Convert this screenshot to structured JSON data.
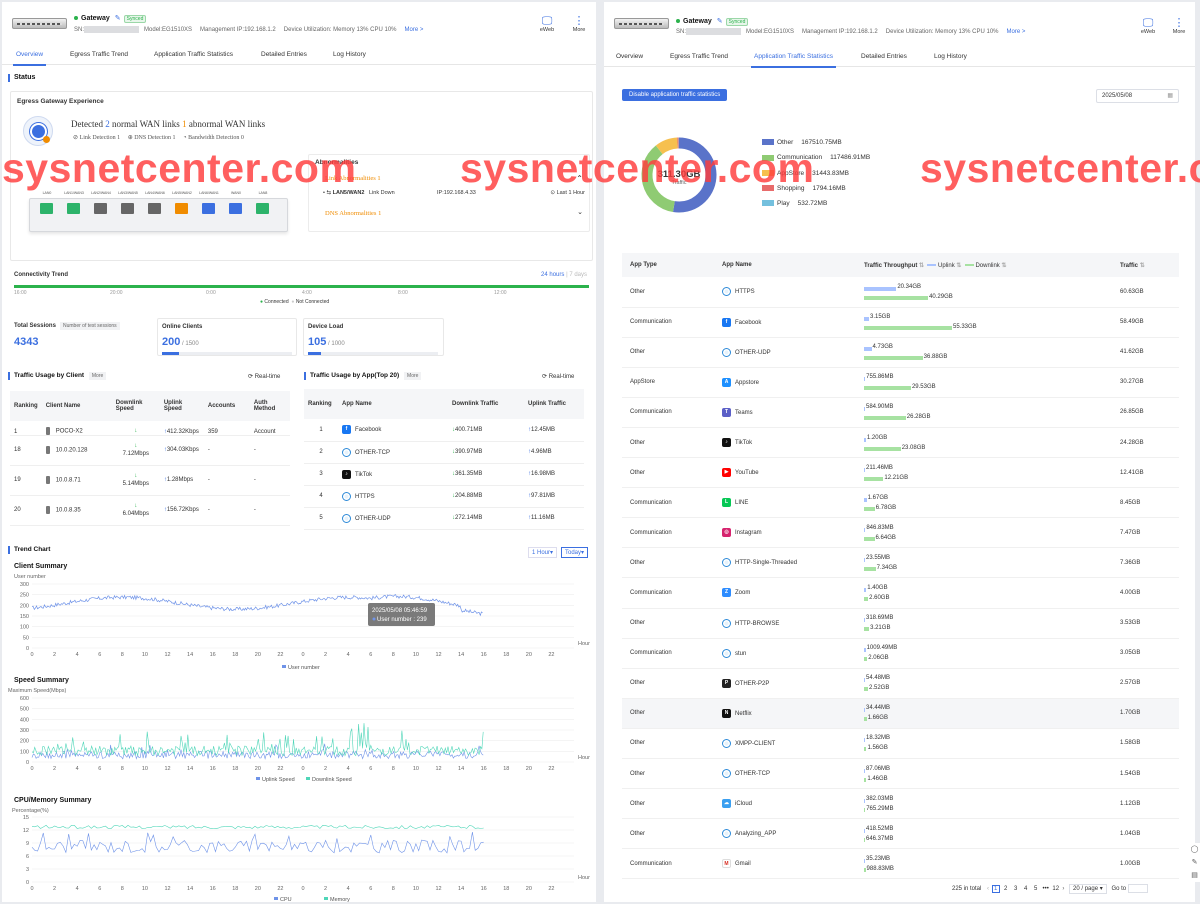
{
  "watermark": "sysnetcenter.com",
  "header": {
    "device_name": "Gateway",
    "synced": "Synced",
    "sn_label": "SN:",
    "model": "Model:EG1510XS",
    "mgmt_ip": "Management IP:192.168.1.2",
    "utilization": "Device Utilization: Memory 13% CPU 10%",
    "more": "More >",
    "eweb": "eWeb",
    "more_btn": "More"
  },
  "tabs": [
    "Overview",
    "Egress Traffic Trend",
    "Application Traffic Statistics",
    "Detailed Entries",
    "Log History"
  ],
  "overview": {
    "status_title": "Status",
    "egress_title": "Egress Gateway Experience",
    "detected_pre": "Detected",
    "normal_count": "2",
    "normal_text": "normal WAN links",
    "abnormal_count": "1",
    "abnormal_text": "abnormal WAN links",
    "link_detection": "Link Detection 1",
    "dns_detection": "DNS Detection 1",
    "bandwidth_detection": "Bandwidth Detection 0",
    "abnormalities_title": "Abnormalities",
    "link_abn": "Link Abnormalities 1",
    "abn_port": "LAN5/WAN2",
    "abn_state": "Link Down",
    "abn_ip": "IP:192.168.4.33",
    "abn_time": "Last 1 Hour",
    "dns_abn": "DNS Abnormalities 1",
    "ports": [
      {
        "label": "LAN0",
        "color": "#2db36a"
      },
      {
        "label": "LAN1/WAN3",
        "color": "#2db36a"
      },
      {
        "label": "LAN2/WAN4",
        "color": "#666"
      },
      {
        "label": "LAN3/WAN5",
        "color": "#666"
      },
      {
        "label": "LAN4/WAN6",
        "color": "#666"
      },
      {
        "label": "LAN5/WAN2",
        "color": "#f08c00"
      },
      {
        "label": "LAN6/WAN1",
        "color": "#3b6fe0"
      },
      {
        "label": "WAN0",
        "color": "#3b6fe0"
      },
      {
        "label": "LAN8",
        "color": "#2db36a"
      }
    ],
    "connectivity_title": "Connectivity Trend",
    "range_24h": "24 hours",
    "range_sep": "|",
    "range_7d": "7 days",
    "conn_ticks": [
      "16:00",
      "20:00",
      "0:00",
      "4:00",
      "8:00",
      "12:00"
    ],
    "legend_connected": "Connected",
    "legend_not_connected": "Not Connected",
    "total_sessions_label": "Total Sessions",
    "test_sessions": "Number of test sessions",
    "total_sessions": "4343",
    "online_clients_label": "Online Clients",
    "online_clients": "200",
    "online_clients_max": "/ 1500",
    "online_clients_frac": 0.13,
    "device_load_label": "Device Load",
    "device_load": "105",
    "device_load_max": "/ 1000",
    "device_load_frac": 0.1,
    "client_usage_title": "Traffic Usage by Client",
    "more": "More",
    "realtime": "Real-time",
    "client_cols": [
      "Ranking",
      "Client Name",
      "Downlink Speed",
      "Uplink Speed",
      "Accounts",
      "Auth Method"
    ],
    "clients": [
      {
        "rank": "1",
        "name": "POCO-X2",
        "down": "",
        "up": "412.32Kbps",
        "acc": "359",
        "auth": "Account"
      },
      {
        "rank": "18",
        "name": "10.0.20.128",
        "down": "7.12Mbps",
        "up": "304.03Kbps",
        "acc": "-",
        "auth": "-"
      },
      {
        "rank": "19",
        "name": "10.0.8.71",
        "down": "5.14Mbps",
        "up": "1.28Mbps",
        "acc": "-",
        "auth": "-"
      },
      {
        "rank": "20",
        "name": "10.0.8.35",
        "down": "6.04Mbps",
        "up": "156.72Kbps",
        "acc": "-",
        "auth": "-"
      }
    ],
    "app_usage_title": "Traffic Usage by App(Top 20)",
    "app_cols": [
      "Ranking",
      "App Name",
      "Downlink Traffic",
      "Uplink Traffic"
    ],
    "apps": [
      {
        "rank": "1",
        "name": "Facebook",
        "down": "400.71MB",
        "up": "12.45MB"
      },
      {
        "rank": "2",
        "name": "OTHER-TCP",
        "down": "390.97MB",
        "up": "4.96MB"
      },
      {
        "rank": "3",
        "name": "TikTok",
        "down": "361.35MB",
        "up": "16.98MB"
      },
      {
        "rank": "4",
        "name": "HTTPS",
        "down": "204.88MB",
        "up": "97.81MB"
      },
      {
        "rank": "5",
        "name": "OTHER-UDP",
        "down": "272.14MB",
        "up": "11.16MB"
      }
    ],
    "trend_title": "Trend Chart",
    "interval": "1 Hour",
    "period": "Today"
  },
  "chart_data": [
    {
      "type": "line",
      "title": "Client Summary",
      "ylabel": "User number",
      "xlabel": "Hour",
      "ylim": [
        0,
        300
      ],
      "yticks": [
        0,
        50,
        100,
        150,
        200,
        250,
        300
      ],
      "xticks": [
        0,
        2,
        4,
        6,
        8,
        10,
        12,
        14,
        16,
        18,
        20,
        22,
        0,
        2,
        4,
        6,
        8,
        10,
        12,
        14,
        16,
        18,
        20,
        22
      ],
      "series": [
        {
          "name": "User number",
          "color": "#6f93e8"
        }
      ],
      "tooltip_time": "2025/05/08 05:46:59",
      "tooltip_value": "User number : 239"
    },
    {
      "type": "line",
      "title": "Speed Summary",
      "ylabel": "Maximum Speed(Mbps)",
      "xlabel": "Hour",
      "ylim": [
        0,
        600
      ],
      "yticks": [
        0,
        100,
        200,
        300,
        400,
        500,
        600
      ],
      "xticks": [
        0,
        2,
        4,
        6,
        8,
        10,
        12,
        14,
        16,
        18,
        20,
        22,
        0,
        2,
        4,
        6,
        8,
        10,
        12,
        14,
        16,
        18,
        20,
        22
      ],
      "series": [
        {
          "name": "Uplink Speed",
          "color": "#6f93e8"
        },
        {
          "name": "Downlink Speed",
          "color": "#4fd6b8"
        }
      ]
    },
    {
      "type": "line",
      "title": "CPU/Memory Summary",
      "ylabel": "Percentage(%)",
      "xlabel": "Hour",
      "ylim": [
        0,
        15
      ],
      "yticks": [
        0,
        3,
        6,
        9,
        12,
        15
      ],
      "xticks": [
        0,
        2,
        4,
        6,
        8,
        10,
        12,
        14,
        16,
        18,
        20,
        22,
        0,
        2,
        4,
        6,
        8,
        10,
        12,
        14,
        16,
        18,
        20,
        22
      ],
      "series": [
        {
          "name": "CPU",
          "color": "#6f93e8"
        },
        {
          "name": "Memory",
          "color": "#4fd6b8"
        }
      ]
    },
    {
      "type": "pie",
      "title": "",
      "total": "311.30GB",
      "total_label": "Traffic",
      "slices": [
        {
          "name": "Other",
          "value_text": "167510.75MB",
          "value": 167510.75,
          "color": "#5a73c9"
        },
        {
          "name": "Communication",
          "value_text": "117486.91MB",
          "value": 117486.91,
          "color": "#8fcb73"
        },
        {
          "name": "AppStore",
          "value_text": "31443.83MB",
          "value": 31443.83,
          "color": "#f6c04f"
        },
        {
          "name": "Shopping",
          "value_text": "1794.16MB",
          "value": 1794.16,
          "color": "#e86b6b"
        },
        {
          "name": "Play",
          "value_text": "532.72MB",
          "value": 532.72,
          "color": "#74c0de"
        }
      ]
    }
  ],
  "stats": {
    "disable_btn": "Disable application traffic statistics",
    "date": "2025/05/08",
    "cols": [
      "App Type",
      "App Name",
      "Traffic Throughput",
      "Uplink",
      "Downlink",
      "Traffic"
    ],
    "rows": [
      {
        "type": "Other",
        "name": "HTTPS",
        "icon": "globe",
        "up": "20.34GB",
        "down": "40.29GB",
        "upv": 20.34,
        "downv": 40.29,
        "total": "60.63GB"
      },
      {
        "type": "Communication",
        "name": "Facebook",
        "icon": "facebook",
        "up": "3.15GB",
        "down": "55.33GB",
        "upv": 3.15,
        "downv": 55.33,
        "total": "58.49GB"
      },
      {
        "type": "Other",
        "name": "OTHER-UDP",
        "icon": "globe",
        "up": "4.73GB",
        "down": "36.88GB",
        "upv": 4.73,
        "downv": 36.88,
        "total": "41.62GB"
      },
      {
        "type": "AppStore",
        "name": "Appstore",
        "icon": "appstore",
        "up": "755.86MB",
        "down": "29.53GB",
        "upv": 0.74,
        "downv": 29.53,
        "total": "30.27GB"
      },
      {
        "type": "Communication",
        "name": "Teams",
        "icon": "teams",
        "up": "584.90MB",
        "down": "26.28GB",
        "upv": 0.57,
        "downv": 26.28,
        "total": "26.85GB"
      },
      {
        "type": "Other",
        "name": "TikTok",
        "icon": "tiktok",
        "up": "1.20GB",
        "down": "23.08GB",
        "upv": 1.2,
        "downv": 23.08,
        "total": "24.28GB"
      },
      {
        "type": "Other",
        "name": "YouTube",
        "icon": "youtube",
        "up": "211.46MB",
        "down": "12.21GB",
        "upv": 0.21,
        "downv": 12.21,
        "total": "12.41GB"
      },
      {
        "type": "Communication",
        "name": "LINE",
        "icon": "line",
        "up": "1.67GB",
        "down": "6.78GB",
        "upv": 1.67,
        "downv": 6.78,
        "total": "8.45GB"
      },
      {
        "type": "Communication",
        "name": "Instagram",
        "icon": "instagram",
        "up": "846.83MB",
        "down": "6.64GB",
        "upv": 0.83,
        "downv": 6.64,
        "total": "7.47GB"
      },
      {
        "type": "Other",
        "name": "HTTP-Single-Threaded",
        "icon": "globe",
        "up": "23.55MB",
        "down": "7.34GB",
        "upv": 0.02,
        "downv": 7.34,
        "total": "7.36GB"
      },
      {
        "type": "Communication",
        "name": "Zoom",
        "icon": "zoom",
        "up": "1.40GB",
        "down": "2.60GB",
        "upv": 1.4,
        "downv": 2.6,
        "total": "4.00GB"
      },
      {
        "type": "Other",
        "name": "HTTP-BROWSE",
        "icon": "globe",
        "up": "318.69MB",
        "down": "3.21GB",
        "upv": 0.31,
        "downv": 3.21,
        "total": "3.53GB"
      },
      {
        "type": "Communication",
        "name": "stun",
        "icon": "globe",
        "up": "1009.49MB",
        "down": "2.06GB",
        "upv": 0.99,
        "downv": 2.06,
        "total": "3.05GB"
      },
      {
        "type": "Other",
        "name": "OTHER-P2P",
        "icon": "p2p",
        "up": "54.48MB",
        "down": "2.52GB",
        "upv": 0.05,
        "downv": 2.52,
        "total": "2.57GB"
      },
      {
        "type": "Other",
        "name": "Netflix",
        "icon": "netflix",
        "up": "34.44MB",
        "down": "1.66GB",
        "upv": 0.03,
        "downv": 1.66,
        "total": "1.70GB"
      },
      {
        "type": "Other",
        "name": "XMPP-CLIENT",
        "icon": "globe",
        "up": "18.32MB",
        "down": "1.56GB",
        "upv": 0.02,
        "downv": 1.56,
        "total": "1.58GB"
      },
      {
        "type": "Other",
        "name": "OTHER-TCP",
        "icon": "globe",
        "up": "87.06MB",
        "down": "1.46GB",
        "upv": 0.09,
        "downv": 1.46,
        "total": "1.54GB"
      },
      {
        "type": "Other",
        "name": "iCloud",
        "icon": "icloud",
        "up": "382.03MB",
        "down": "765.29MB",
        "upv": 0.37,
        "downv": 0.75,
        "total": "1.12GB"
      },
      {
        "type": "Other",
        "name": "Analyzing_APP",
        "icon": "globe",
        "up": "418.52MB",
        "down": "646.37MB",
        "upv": 0.41,
        "downv": 0.63,
        "total": "1.04GB"
      },
      {
        "type": "Communication",
        "name": "Gmail",
        "icon": "gmail",
        "up": "35.23MB",
        "down": "988.83MB",
        "upv": 0.03,
        "downv": 0.97,
        "total": "1.00GB"
      }
    ],
    "pagination": {
      "total": "225 in total",
      "pages": [
        "1",
        "2",
        "3",
        "4",
        "5",
        "•••",
        "12"
      ],
      "current": "1",
      "per_page": "20 / page",
      "goto": "Go to"
    }
  }
}
